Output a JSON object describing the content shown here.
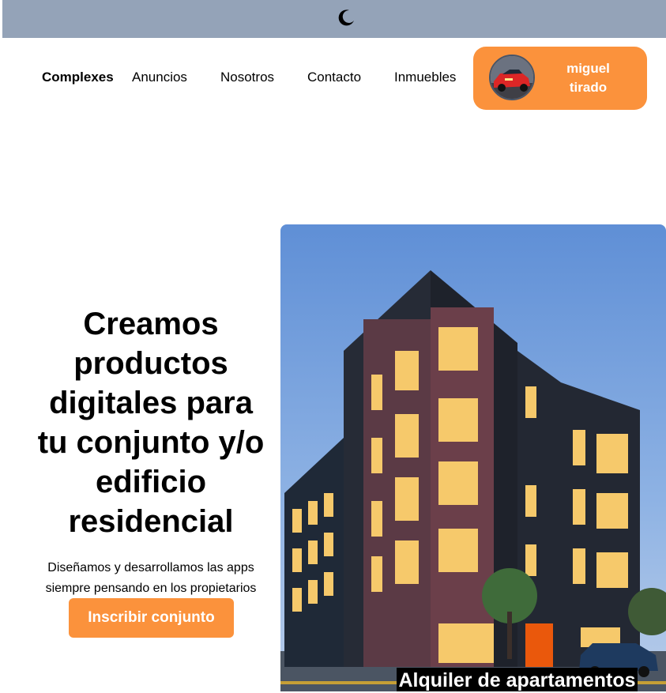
{
  "topbar": {
    "theme_toggle_icon": "moon-icon"
  },
  "nav": {
    "brand": "Complexes",
    "links": [
      "Anuncios",
      "Nosotros",
      "Contacto",
      "Inmuebles"
    ]
  },
  "user": {
    "first_name": "miguel",
    "last_name": "tirado",
    "avatar_icon": "red-car-avatar"
  },
  "hero": {
    "title_lines": [
      "Creamos",
      "productos",
      "digitales para",
      "tu conjunto y/o",
      "edificio",
      "residencial"
    ],
    "subtitle_lines": [
      "Diseñamos y desarrollamos las apps",
      "siempre pensando en los propietarios"
    ],
    "cta_label": "Inscribir conjunto",
    "image_caption": "Alquiler de apartamentos"
  },
  "colors": {
    "accent": "#fb923c",
    "topbar": "#94a3b8"
  }
}
